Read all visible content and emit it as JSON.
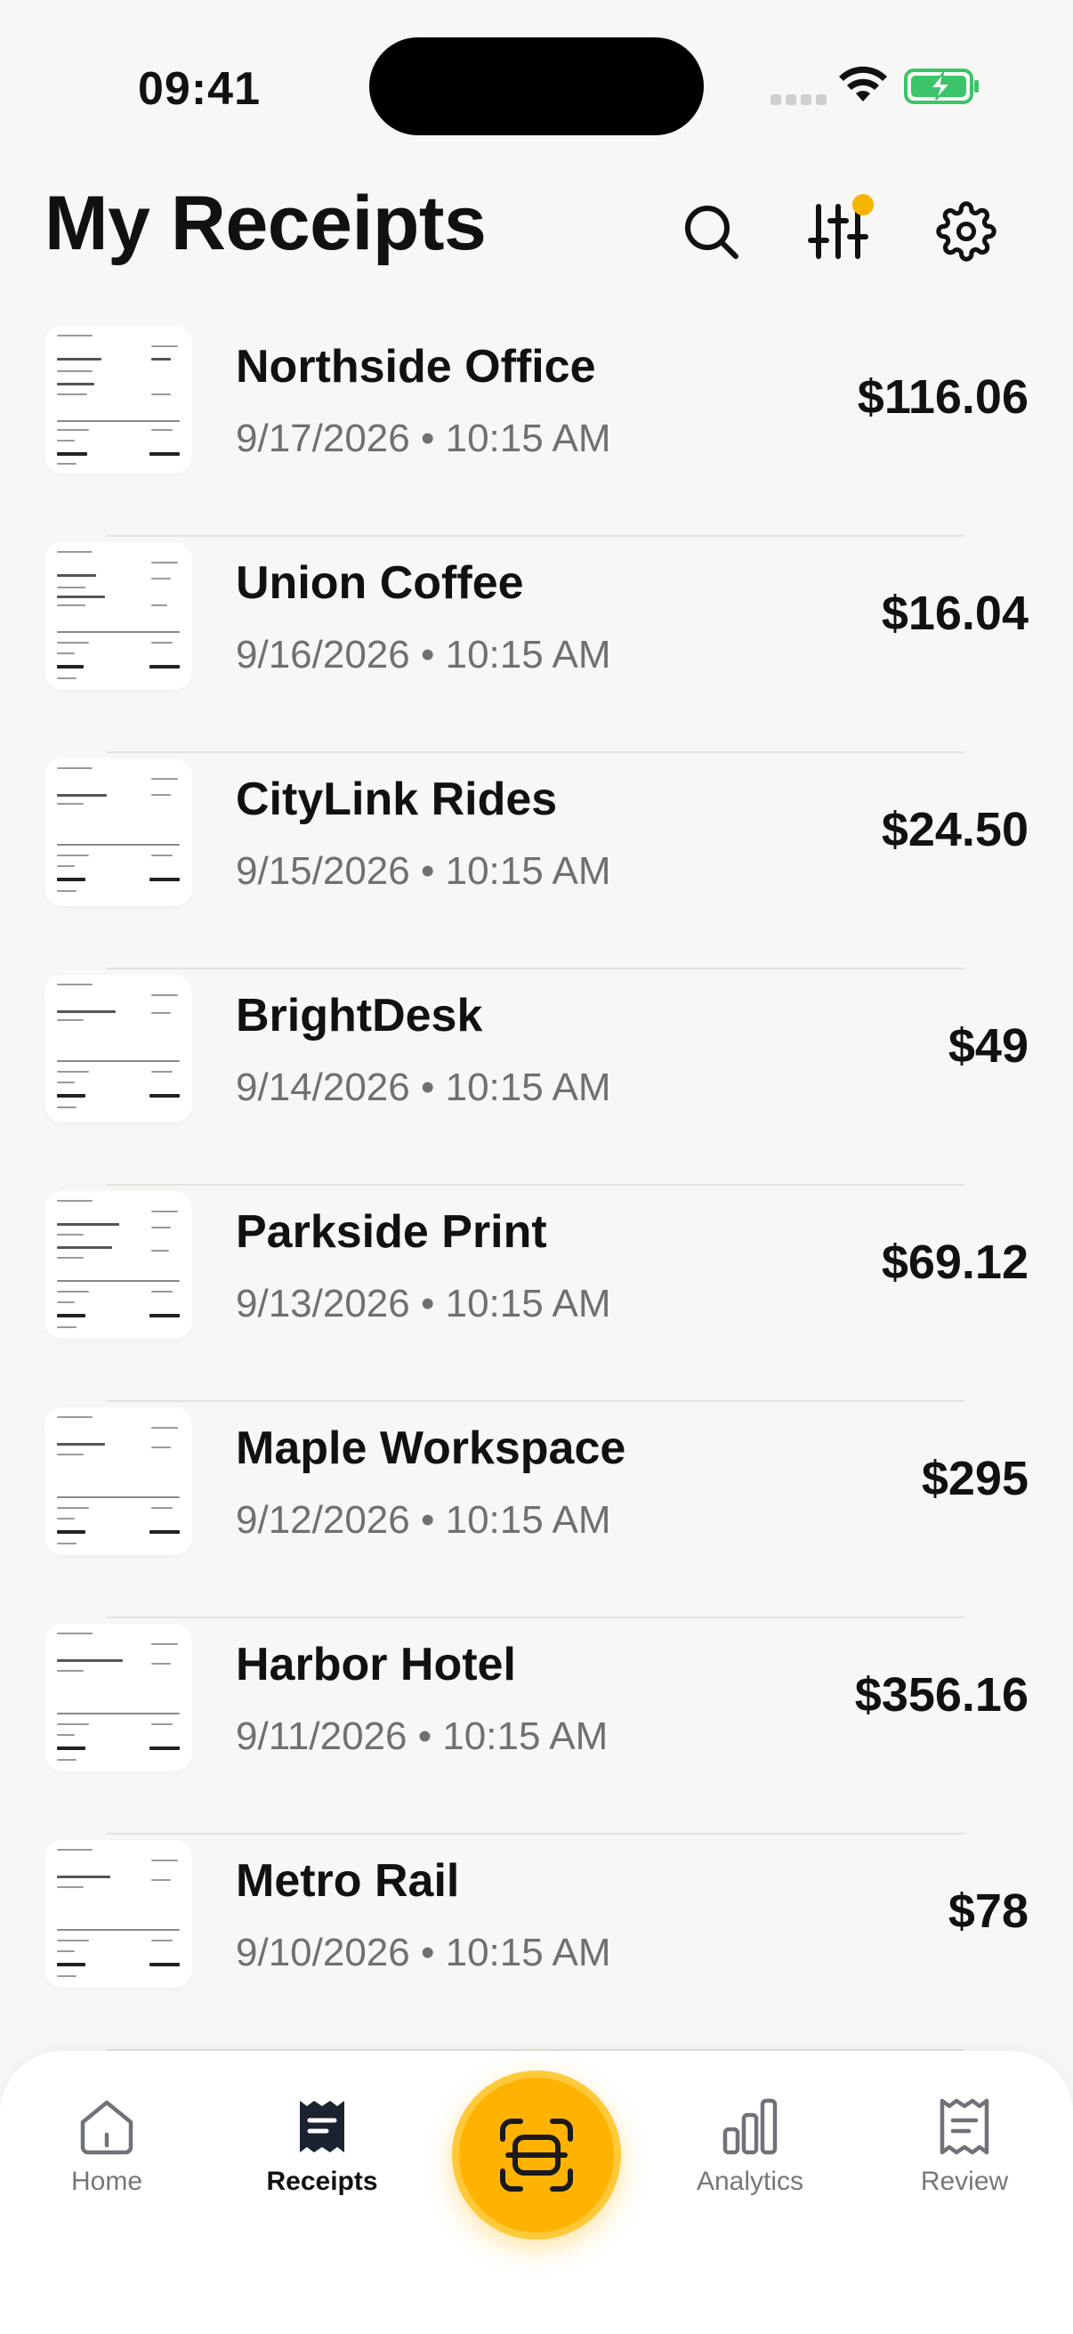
{
  "status": {
    "time": "09:41"
  },
  "header": {
    "title": "My Receipts",
    "filter_indicator_color": "#f6b400",
    "icons": [
      "search-icon",
      "sliders-icon",
      "gear-icon"
    ]
  },
  "receipts": [
    {
      "merchant": "Northside Office",
      "date": "9/17/2026 • 10:15 AM",
      "amount": "$116.06"
    },
    {
      "merchant": "Union Coffee",
      "date": "9/16/2026 • 10:15 AM",
      "amount": "$16.04"
    },
    {
      "merchant": "CityLink Rides",
      "date": "9/15/2026 • 10:15 AM",
      "amount": "$24.50"
    },
    {
      "merchant": "BrightDesk",
      "date": "9/14/2026 • 10:15 AM",
      "amount": "$49"
    },
    {
      "merchant": "Parkside Print",
      "date": "9/13/2026 • 10:15 AM",
      "amount": "$69.12"
    },
    {
      "merchant": "Maple Workspace",
      "date": "9/12/2026 • 10:15 AM",
      "amount": "$295"
    },
    {
      "merchant": "Harbor Hotel",
      "date": "9/11/2026 • 10:15 AM",
      "amount": "$356.16"
    },
    {
      "merchant": "Metro Rail",
      "date": "9/10/2026 • 10:15 AM",
      "amount": "$78"
    }
  ],
  "tabbar": {
    "home": "Home",
    "receipts": "Receipts",
    "analytics": "Analytics",
    "review": "Review",
    "active": "receipts",
    "accent_color": "#ffb300"
  }
}
